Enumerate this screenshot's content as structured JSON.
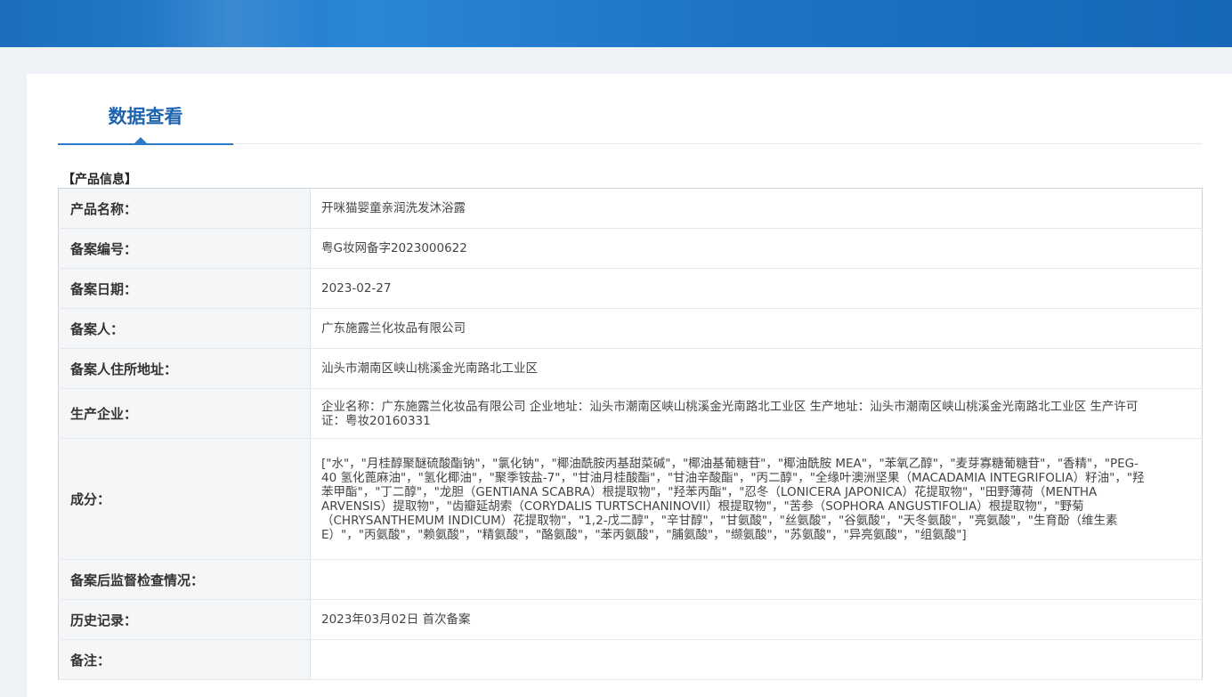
{
  "tab": {
    "label": "数据查看"
  },
  "section_title": "【产品信息】",
  "rows": [
    {
      "label": "产品名称：",
      "value": "开咪猫婴童亲润洗发沐浴露"
    },
    {
      "label": "备案编号：",
      "value": "粤G妆网备字2023000622"
    },
    {
      "label": "备案日期：",
      "value": "2023-02-27"
    },
    {
      "label": "备案人：",
      "value": "广东施露兰化妆品有限公司"
    },
    {
      "label": "备案人住所地址：",
      "value": "汕头市潮南区峡山桃溪金光南路北工业区"
    },
    {
      "label": "生产企业：",
      "value": "企业名称：广东施露兰化妆品有限公司 企业地址：汕头市潮南区峡山桃溪金光南路北工业区 生产地址：汕头市潮南区峡山桃溪金光南路北工业区 生产许可证：粤妆20160331"
    },
    {
      "label": "成分：",
      "value": "[\"水\"，\"月桂醇聚醚硫酸酯钠\"，\"氯化钠\"，\"椰油酰胺丙基甜菜碱\"，\"椰油基葡糖苷\"，\"椰油酰胺 MEA\"，\"苯氧乙醇\"，\"麦芽寡糖葡糖苷\"，\"香精\"，\"PEG-40 氢化蓖麻油\"，\"氢化椰油\"，\"聚季铵盐-7\"，\"甘油月桂酸酯\"，\"甘油辛酸酯\"，\"丙二醇\"，\"全缘叶澳洲坚果（MACADAMIA INTEGRIFOLIA）籽油\"，\"羟苯甲酯\"，\"丁二醇\"，\"龙胆（GENTIANA SCABRA）根提取物\"，\"羟苯丙酯\"，\"忍冬（LONICERA JAPONICA）花提取物\"，\"田野薄荷（MENTHA ARVENSIS）提取物\"，\"齿瓣延胡索（CORYDALIS TURTSCHANINOVII）根提取物\"，\"苦参（SOPHORA ANGUSTIFOLIA）根提取物\"，\"野菊（CHRYSANTHEMUM INDICUM）花提取物\"，\"1,2-戊二醇\"，\"辛甘醇\"，\"甘氨酸\"，\"丝氨酸\"，\"谷氨酸\"，\"天冬氨酸\"，\"亮氨酸\"，\"生育酚（维生素E）\"，\"丙氨酸\"，\"赖氨酸\"，\"精氨酸\"，\"酪氨酸\"，\"苯丙氨酸\"，\"脯氨酸\"，\"缬氨酸\"，\"苏氨酸\"，\"异亮氨酸\"，\"组氨酸\"]"
    },
    {
      "label": "备案后监督检查情况：",
      "value": ""
    },
    {
      "label": "历史记录：",
      "value": "2023年03月02日 首次备案"
    },
    {
      "label": "备注：",
      "value": ""
    }
  ]
}
